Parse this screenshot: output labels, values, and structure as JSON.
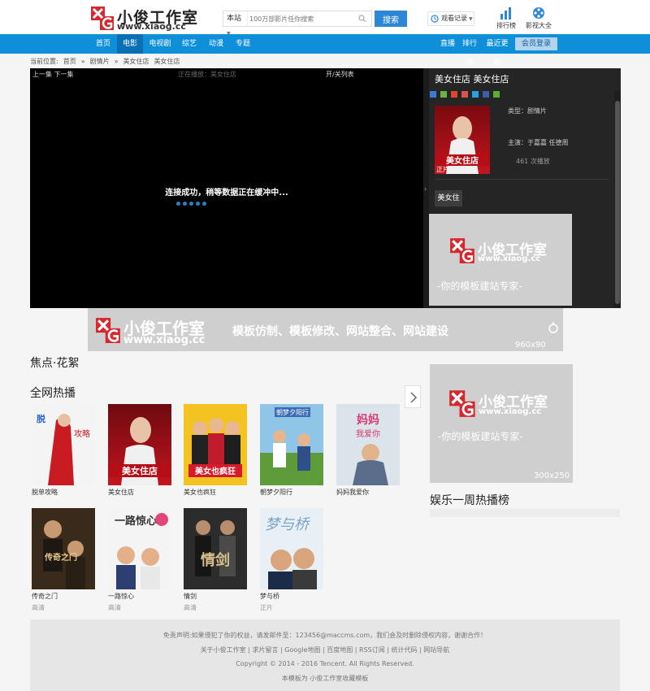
{
  "brand": {
    "logo_letters": "XG",
    "name": "小俊工作室",
    "url": "www.xiaog.cc"
  },
  "search": {
    "scope": "本站",
    "placeholder": "100万部影片任你搜索",
    "button": "搜索"
  },
  "history": {
    "label": "观看记录"
  },
  "top_tools": [
    {
      "label": "排行榜",
      "icon": "bar-chart-icon"
    },
    {
      "label": "影视大全",
      "icon": "film-reel-icon"
    }
  ],
  "nav": {
    "items": [
      "首页",
      "电影",
      "电视剧",
      "综艺",
      "动漫",
      "专题"
    ],
    "active": "电影",
    "right_items": [
      "直播",
      "排行榜",
      "最近更新"
    ],
    "member_button": "会员登录"
  },
  "breadcrumb": [
    "当前位置:",
    "首页",
    "»",
    "剧情片",
    "»",
    "美女住店",
    "美女住店"
  ],
  "player": {
    "prev_next": "上一集 下一集",
    "now_playing": "正在播放：美女住店",
    "toggle_list": "开/关列表",
    "buffer_message": "连接成功，稍等数据正在缓冲中..."
  },
  "side_panel": {
    "title": "美女住店 美女住店",
    "poster_tag": "正片",
    "type_line": "类型：剧情片",
    "actors_line": "主演：于嘉嘉 任德周",
    "plays_line": "461 次播放",
    "episode_button": "美女住"
  },
  "ads": {
    "name": "小俊工作室",
    "url": "www.xiaog.cc",
    "banner_slogan": "模板仿制、模板修改、网站整合、网站建设",
    "banner_size": "960x90",
    "box_slogan": "-你的模板建站专家-",
    "box_size": "300x250"
  },
  "sections": {
    "focus": "焦点·花絮",
    "hot": "全网热播",
    "weekly": "娱乐一周热播榜"
  },
  "hot_movies": [
    {
      "title": "脱单攻略",
      "sub": "",
      "poster_text": "脱单攻略"
    },
    {
      "title": "美女住店",
      "sub": "",
      "poster_text": "美女住店"
    },
    {
      "title": "美女也疯狂",
      "sub": "",
      "poster_text": "美女也疯狂"
    },
    {
      "title": "朝梦夕阳行",
      "sub": "",
      "poster_text": "朝梦夕阳行"
    },
    {
      "title": "妈妈我爱你",
      "sub": "",
      "poster_text": "妈妈我爱你"
    },
    {
      "title": "传奇之门",
      "sub": "高清",
      "poster_text": "传奇之门"
    },
    {
      "title": "一路惊心",
      "sub": "高清",
      "poster_text": "一路惊心"
    },
    {
      "title": "情剑",
      "sub": "高清",
      "poster_text": "情剑"
    },
    {
      "title": "梦与桥",
      "sub": "正片",
      "poster_text": "梦与桥"
    }
  ],
  "footer": {
    "disclaimer": "免责声明:如果侵犯了你的权益，请发邮件至：123456@maccms.com，我们会及时删除侵权内容，谢谢合作！",
    "links": "关于小俊工作室 | 求片留言 | Google地图 | 百度地图 | RSS订阅 | 统计代码 | 网站导航",
    "copyright": "Copyright © 2014 - 2016 Tencent. All Rights Reserved.",
    "template": "本模板为 小俊工作室收藏模板"
  },
  "colors": {
    "nav_blue": "#0e8fd8",
    "nav_active": "#0a6fb5",
    "logo_red": "#d7282f",
    "search_button": "#2d86d6"
  }
}
